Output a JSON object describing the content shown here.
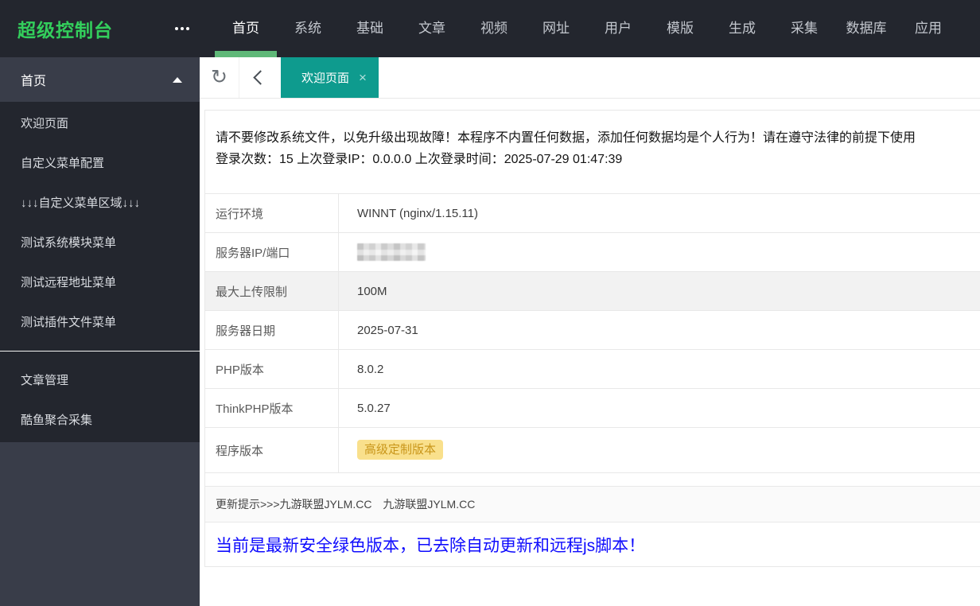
{
  "app": {
    "title": "超级控制台"
  },
  "colors": {
    "header_bg": "#23262E",
    "sidebar_bg": "#393D49",
    "sidebar_submenu_bg": "#23262E",
    "logo_green": "#33CF5C",
    "nav_active_indicator": "#5FB878",
    "active_tab_bg": "#0E9B8E",
    "badge_bg": "#F9E08C",
    "badge_text": "#C9961A",
    "status_blue": "#0F0CFE",
    "highlight_row_bg": "#F2F2F2"
  },
  "icons": {
    "more": "more-dots",
    "refresh": "refresh-circular-arrow",
    "back": "chevron-left",
    "tab_close": "×",
    "section_collapse": "triangle-up"
  },
  "topnav": {
    "items": [
      {
        "label": "首页",
        "active": true
      },
      {
        "label": "系统"
      },
      {
        "label": "基础"
      },
      {
        "label": "文章"
      },
      {
        "label": "视频"
      },
      {
        "label": "网址"
      },
      {
        "label": "用户"
      },
      {
        "label": "模版"
      },
      {
        "label": "生成"
      },
      {
        "label": "采集"
      },
      {
        "label": "数据库"
      },
      {
        "label": "应用"
      }
    ]
  },
  "sidebar": {
    "section": {
      "label": "首页",
      "expanded": true
    },
    "menu_items": [
      {
        "label": "欢迎页面"
      },
      {
        "label": "自定义菜单配置"
      },
      {
        "label": "↓↓↓自定义菜单区域↓↓↓"
      },
      {
        "label": "测试系统模块菜单"
      },
      {
        "label": "测试远程地址菜单"
      },
      {
        "label": "测试插件文件菜单"
      }
    ],
    "bottom_items": [
      {
        "label": "文章管理"
      },
      {
        "label": "酷鱼聚合采集"
      }
    ]
  },
  "tabbar": {
    "active_tab": {
      "label": "欢迎页面",
      "close": "×"
    }
  },
  "main": {
    "notice": "请不要修改系统文件，以免升级出现故障！本程序不内置任何数据，添加任何数据均是个人行为！请在遵守法律的前提下使用",
    "login_info": "登录次数：15 上次登录IP：0.0.0.0 上次登录时间：2025-07-29 01:47:39",
    "table": {
      "rows": [
        {
          "label": "运行环境",
          "value": "WINNT (nginx/1.15.11)",
          "type": "text"
        },
        {
          "label": "服务器IP/端口",
          "value": "",
          "type": "redacted"
        },
        {
          "label": "最大上传限制",
          "value": "100M",
          "type": "text",
          "highlighted": true
        },
        {
          "label": "服务器日期",
          "value": "2025-07-31",
          "type": "text"
        },
        {
          "label": "PHP版本",
          "value": "8.0.2",
          "type": "text"
        },
        {
          "label": "ThinkPHP版本",
          "value": "5.0.27",
          "type": "text"
        },
        {
          "label": "程序版本",
          "value": "高级定制版本",
          "type": "badge"
        }
      ]
    },
    "update_notice": "更新提示>>>九游联盟JYLM.CC　九游联盟JYLM.CC",
    "status_message": "当前是最新安全绿色版本，已去除自动更新和远程js脚本！"
  }
}
